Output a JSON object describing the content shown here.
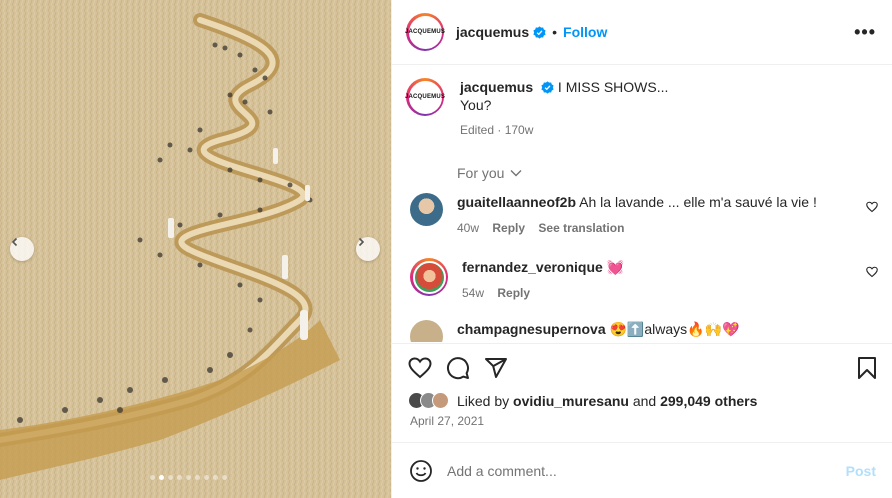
{
  "post": {
    "username": "jacquemus",
    "follow_label": "Follow",
    "separator": "•",
    "avatar_text": "JACQUEMUS",
    "more_label": "•••"
  },
  "caption": {
    "username": "jacquemus",
    "line1": "I MISS SHOWS...",
    "line2": "You?",
    "meta": "Edited · 170w"
  },
  "for_you_label": "For you",
  "comments": [
    {
      "username": "guaitellaanneof2b",
      "text": "Ah la lavande ... elle m'a sauvé la vie !",
      "age": "40w",
      "reply": "Reply",
      "translate": "See translation"
    },
    {
      "username": "fernandez_veronique",
      "text": "💓",
      "age": "54w",
      "reply": "Reply"
    },
    {
      "username": "champagnesupernova",
      "text": "😍⬆️always🔥🙌💖"
    }
  ],
  "likes": {
    "prefix": "Liked by",
    "user": "ovidiu_muresanu",
    "connector": "and",
    "others": "299,049 others"
  },
  "date": "April 27, 2021",
  "add_comment": {
    "placeholder": "Add a comment...",
    "post_label": "Post"
  },
  "carousel": {
    "dot_count": 9,
    "active_index": 1
  },
  "colors": {
    "link_blue": "#0095f6",
    "verified": "#0095f6",
    "post_disabled": "#b2dffc",
    "heart_pink": "#ff3ea5"
  }
}
